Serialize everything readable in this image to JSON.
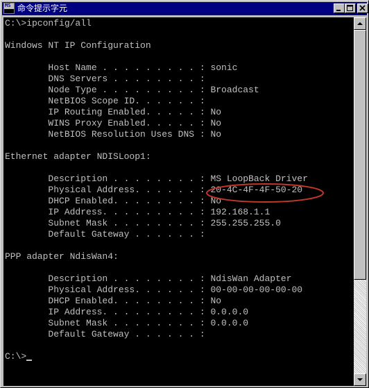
{
  "window": {
    "title": "命令提示字元",
    "icon_label": "MS"
  },
  "console": {
    "text_color": "#c0c0c0",
    "background": "#000000",
    "highlight_color": "#c0392b",
    "lines": [
      "C:\\>ipconfig/all",
      "",
      "Windows NT IP Configuration",
      "",
      "        Host Name . . . . . . . . . : sonic",
      "        DNS Servers . . . . . . . . :",
      "        Node Type . . . . . . . . . : Broadcast",
      "        NetBIOS Scope ID. . . . . . :",
      "        IP Routing Enabled. . . . . : No",
      "        WINS Proxy Enabled. . . . . : No",
      "        NetBIOS Resolution Uses DNS : No",
      "",
      "Ethernet adapter NDISLoop1:",
      "",
      "        Description . . . . . . . . : MS LoopBack Driver",
      "        Physical Address. . . . . . : 20-4C-4F-4F-50-20",
      "        DHCP Enabled. . . . . . . . : No",
      "        IP Address. . . . . . . . . : 192.168.1.1",
      "        Subnet Mask . . . . . . . . : 255.255.255.0",
      "        Default Gateway . . . . . . :",
      "",
      "PPP adapter NdisWan4:",
      "",
      "        Description . . . . . . . . : NdisWan Adapter",
      "        Physical Address. . . . . . : 00-00-00-00-00-00",
      "        DHCP Enabled. . . . . . . . : No",
      "        IP Address. . . . . . . . . : 0.0.0.0",
      "        Subnet Mask . . . . . . . . : 0.0.0.0",
      "        Default Gateway . . . . . . :",
      "",
      "C:\\>"
    ]
  }
}
